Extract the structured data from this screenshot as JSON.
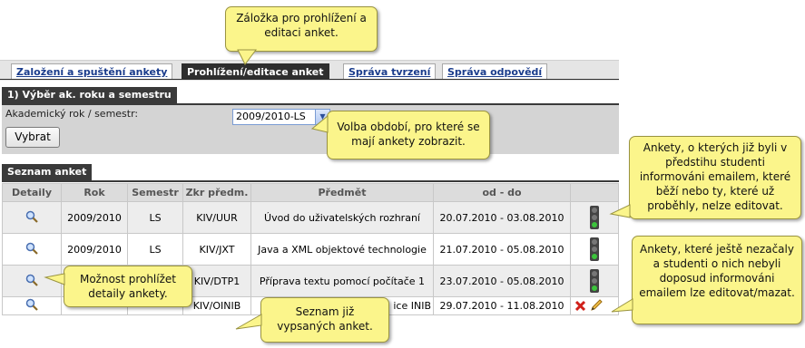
{
  "tabs": [
    {
      "label": "Založení a spuštění ankety",
      "active": false
    },
    {
      "label": "Prohlížení/editace anket",
      "active": true
    },
    {
      "label": "Správa tvrzení",
      "active": false
    },
    {
      "label": "Správa odpovědí",
      "active": false
    }
  ],
  "section1": {
    "title": "1) Výběr ak. roku a semestru",
    "year_label": "Akademický rok / semestr:",
    "year_value": "2009/2010-LS",
    "submit_label": "Vybrat"
  },
  "section2": {
    "title": "Seznam anket",
    "columns": [
      "Detaily",
      "Rok",
      "Semestr",
      "Zkr předm.",
      "Předmět",
      "od - do",
      ""
    ],
    "rows": [
      {
        "rok": "2009/2010",
        "semestr": "LS",
        "zkr": "KIV/UUR",
        "predmet": "Úvod do uživatelských rozhraní",
        "od_do": "20.07.2010 - 03.08.2010",
        "status": "traffic-light"
      },
      {
        "rok": "2009/2010",
        "semestr": "LS",
        "zkr": "KIV/JXT",
        "predmet": "Java a XML objektové technologie",
        "od_do": "21.07.2010 - 05.08.2010",
        "status": "traffic-light"
      },
      {
        "rok": "",
        "semestr": "",
        "zkr": "KIV/DTP1",
        "predmet": "Příprava textu pomocí počítače 1",
        "od_do": "23.07.2010 - 05.08.2010",
        "status": "traffic-light"
      },
      {
        "rok": "",
        "semestr": "",
        "zkr": "KIV/OINIB",
        "predmet": "ice INIB",
        "od_do": "29.07.2010 - 11.08.2010",
        "status": "edit-delete"
      }
    ]
  },
  "tooltips": {
    "tabs_tip": "Záložka pro prohlížení a editaci anket.",
    "period_tip": "Volba období, pro které se mají ankety zobrazit.",
    "informed_tip": "Ankety, o kterých již byli v předstihu studenti informováni emailem, které běží nebo ty, které už proběhly, nelze editovat.",
    "editable_tip": "Ankety, které ještě nezačaly a studenti o nich nebyli doposud informováni emailem lze editovat/mazat.",
    "details_tip": "Možnost prohlížet detaily ankety.",
    "list_tip": "Seznam již vypsaných anket."
  },
  "colors": {
    "header_dark": "#3a3a3a",
    "tooltip_bg": "#fbf58b",
    "link": "#1a3c8c"
  }
}
